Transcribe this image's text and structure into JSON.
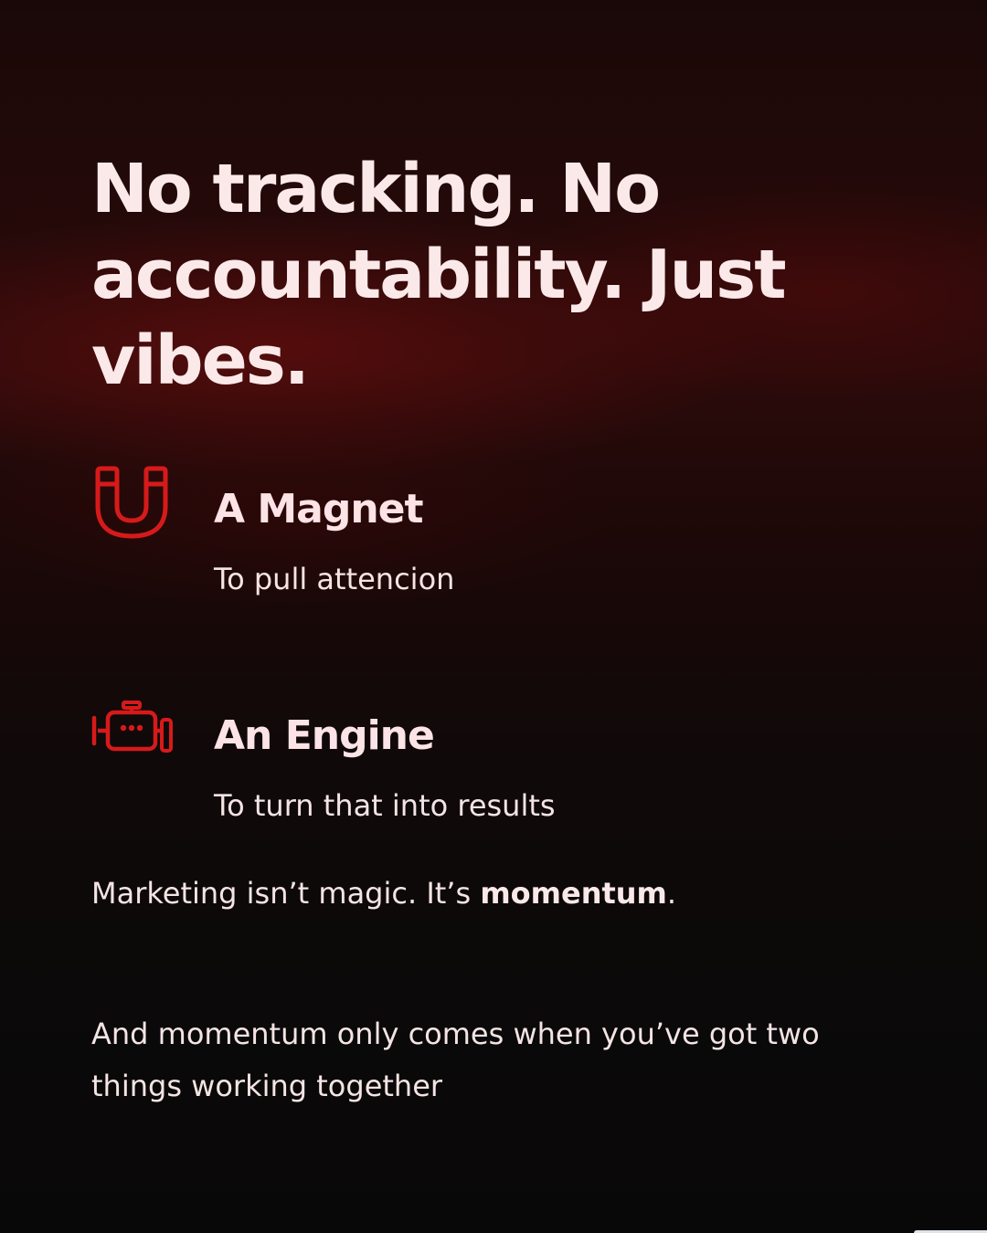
{
  "headline": "No tracking. No accountability. Just vibes.",
  "features": [
    {
      "icon": "magnet-icon",
      "title": "A Magnet",
      "description": "To pull attencion"
    },
    {
      "icon": "engine-icon",
      "title": "An Engine",
      "description": "To turn that into results"
    }
  ],
  "statement": {
    "lead": "Marketing isn’t magic. It’s ",
    "emphasis": "momentum",
    "end": "."
  },
  "closing": "And momentum only comes when you’ve got two things working together",
  "colors": {
    "accent": "#d61a1a",
    "text": "#f8e7e7",
    "background": "#0b0808",
    "glow": "#7a0e0e"
  }
}
